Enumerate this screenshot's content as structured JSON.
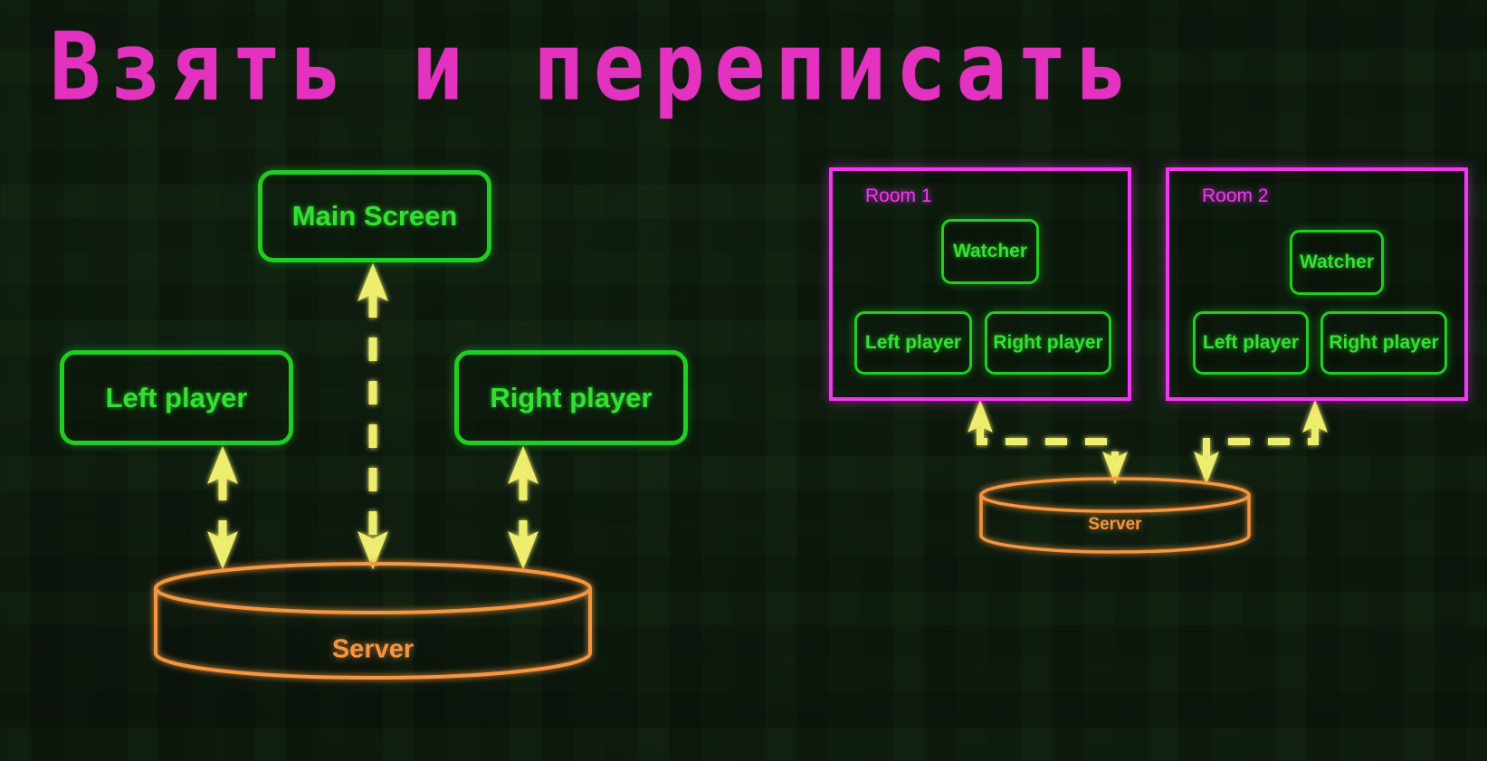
{
  "page": {
    "title": "Взять и переписать",
    "background_color": "#0a110a"
  },
  "colors": {
    "title_magenta": "#e432c0",
    "node_green": "#22cc22",
    "node_text_green": "#33e033",
    "room_magenta": "#f833f8",
    "arrow_yellow": "#eeee6e",
    "server_orange": "#f5963f"
  },
  "left_diagram": {
    "name": "single-game-architecture",
    "nodes": [
      {
        "id": "main-screen",
        "label": "Main Screen"
      },
      {
        "id": "left-player",
        "label": "Left player"
      },
      {
        "id": "right-player",
        "label": "Right player"
      }
    ],
    "server": {
      "id": "server",
      "label": "Server",
      "shape": "cylinder"
    },
    "connections": [
      {
        "from": "server",
        "to": "main-screen",
        "style": "dashed",
        "arrows": "both"
      },
      {
        "from": "server",
        "to": "left-player",
        "style": "dashed",
        "arrows": "both"
      },
      {
        "from": "server",
        "to": "right-player",
        "style": "dashed",
        "arrows": "both"
      }
    ]
  },
  "right_diagram": {
    "name": "multi-room-architecture",
    "rooms": [
      {
        "id": "room-1",
        "label": "Room 1",
        "nodes": [
          {
            "id": "room1-watcher",
            "label": "Watcher"
          },
          {
            "id": "room1-left-player",
            "label": "Left player"
          },
          {
            "id": "room1-right-player",
            "label": "Right player"
          }
        ]
      },
      {
        "id": "room-2",
        "label": "Room 2",
        "nodes": [
          {
            "id": "room2-watcher",
            "label": "Watcher"
          },
          {
            "id": "room2-left-player",
            "label": "Left player"
          },
          {
            "id": "room2-right-player",
            "label": "Right player"
          }
        ]
      }
    ],
    "server": {
      "id": "server-2",
      "label": "Server",
      "shape": "cylinder"
    },
    "connections": [
      {
        "from": "server-2",
        "to": "room-1",
        "style": "dashed",
        "arrows": "both",
        "routing": "elbow"
      },
      {
        "from": "server-2",
        "to": "room-2",
        "style": "dashed",
        "arrows": "both",
        "routing": "elbow"
      }
    ]
  }
}
